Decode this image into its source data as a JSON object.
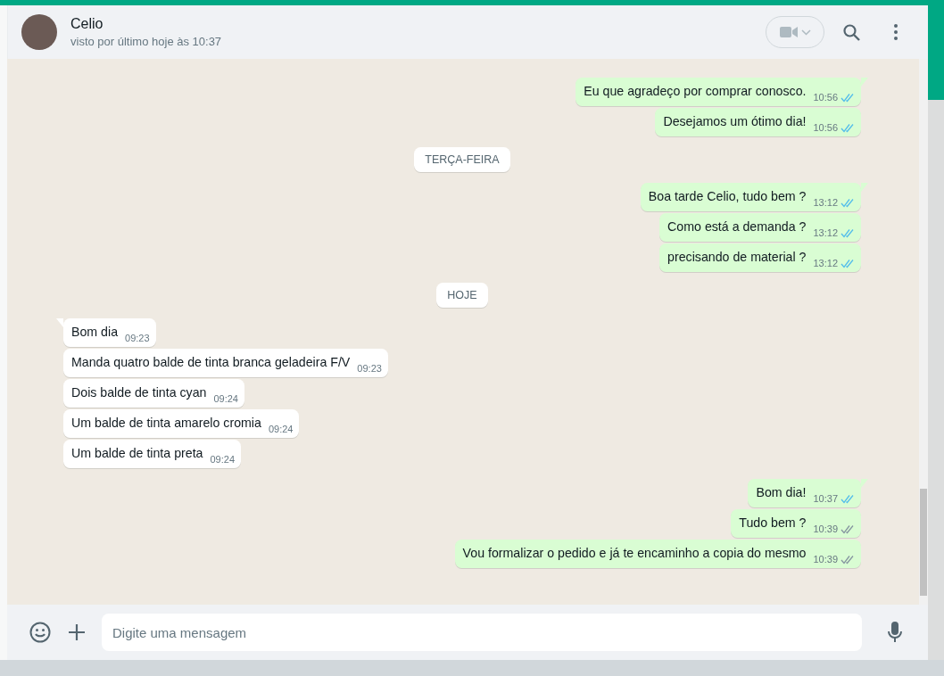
{
  "contact": {
    "name": "Celio",
    "status": "visto por último hoje às 10:37"
  },
  "messages": [
    {
      "kind": "out",
      "text": "Eu que agradeço por comprar conosco.",
      "time": "10:56",
      "read": true,
      "tail": true
    },
    {
      "kind": "out",
      "text": "Desejamos um ótimo dia!",
      "time": "10:56",
      "read": true,
      "tail": false
    },
    {
      "kind": "date",
      "text": "TERÇA-FEIRA"
    },
    {
      "kind": "out",
      "text": "Boa tarde Celio, tudo bem ?",
      "time": "13:12",
      "read": true,
      "tail": true
    },
    {
      "kind": "out",
      "text": "Como está a demanda ?",
      "time": "13:12",
      "read": true,
      "tail": false
    },
    {
      "kind": "out",
      "text": "precisando de material ?",
      "time": "13:12",
      "read": true,
      "tail": false
    },
    {
      "kind": "date",
      "text": "HOJE"
    },
    {
      "kind": "in",
      "text": "Bom dia",
      "time": "09:23",
      "tail": true
    },
    {
      "kind": "in",
      "text": "Manda quatro balde de tinta branca geladeira F/V",
      "time": "09:23",
      "tail": false
    },
    {
      "kind": "in",
      "text": "Dois balde de tinta cyan",
      "time": "09:24",
      "tail": false
    },
    {
      "kind": "in",
      "text": "Um balde de tinta amarelo cromia",
      "time": "09:24",
      "tail": false
    },
    {
      "kind": "in",
      "text": "Um balde de tinta preta",
      "time": "09:24",
      "tail": false
    },
    {
      "kind": "out",
      "text": "Bom dia!",
      "time": "10:37",
      "read": true,
      "tail": true
    },
    {
      "kind": "out",
      "text": "Tudo bem ?",
      "time": "10:39",
      "read": false,
      "tail": false
    },
    {
      "kind": "out",
      "text": "Vou formalizar o pedido e já te encaminho a copia do mesmo",
      "time": "10:39",
      "read": false,
      "tail": false
    }
  ],
  "composer": {
    "placeholder": "Digite uma mensagem"
  }
}
